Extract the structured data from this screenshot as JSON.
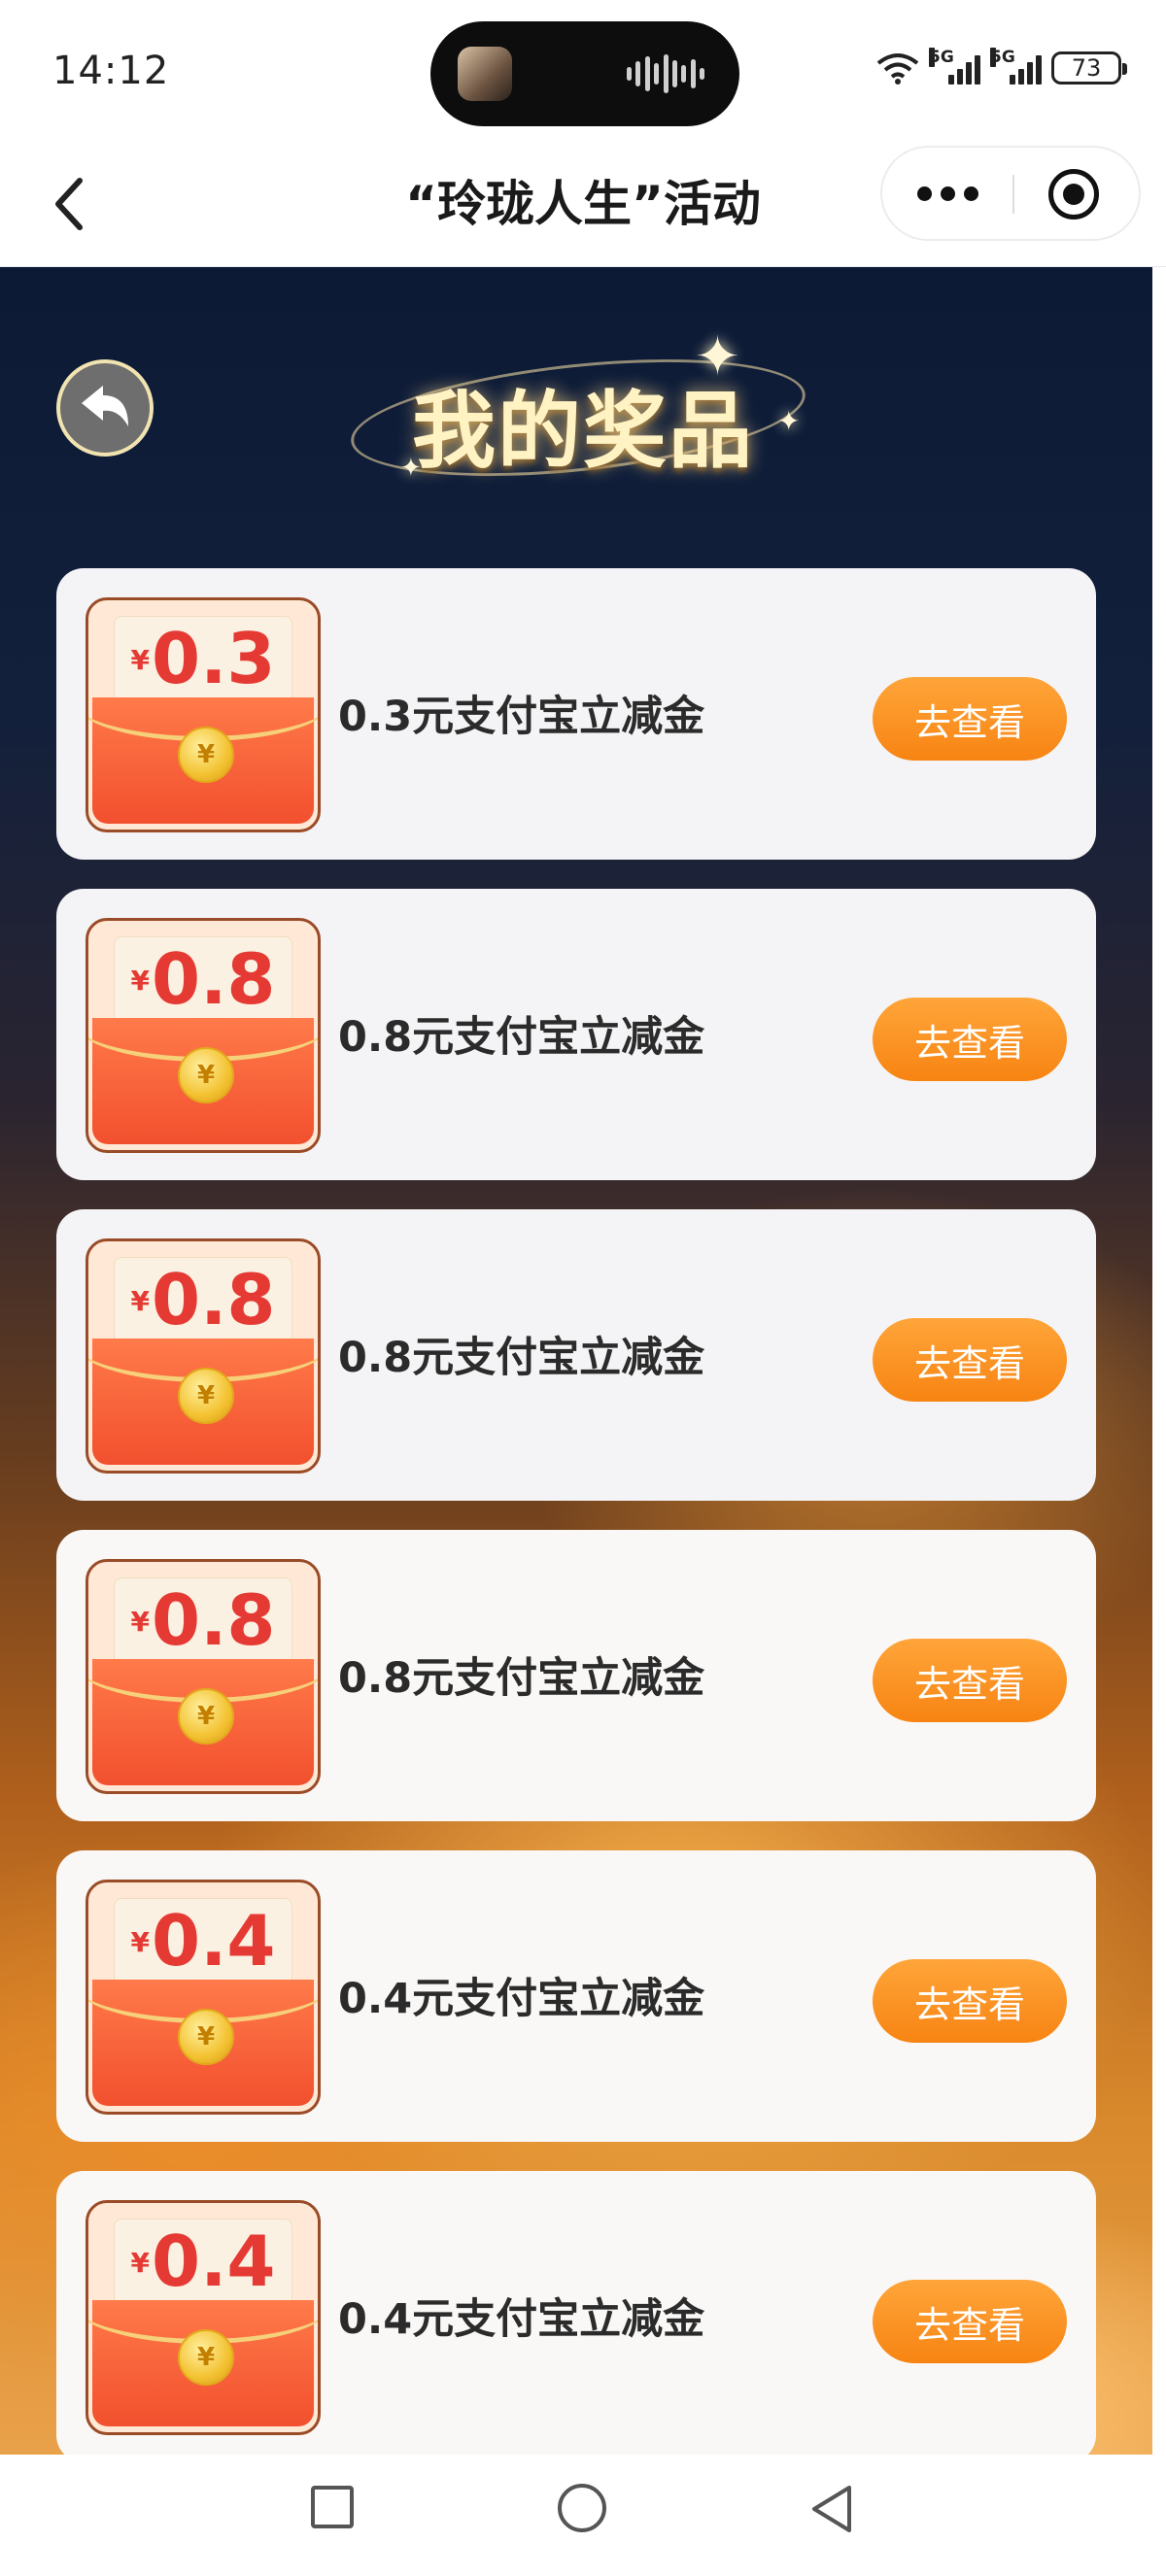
{
  "status_bar": {
    "time": "14:12",
    "signal_1_tag": "5G",
    "signal_2_tag": "5G",
    "battery": "73"
  },
  "nav": {
    "title": "“玲珑人生”活动"
  },
  "page": {
    "heading": "我的奖品"
  },
  "prizes": [
    {
      "currency": "¥",
      "amount": "0.3",
      "name": "0.3元支付宝立减金",
      "button": "去查看"
    },
    {
      "currency": "¥",
      "amount": "0.8",
      "name": "0.8元支付宝立减金",
      "button": "去查看"
    },
    {
      "currency": "¥",
      "amount": "0.8",
      "name": "0.8元支付宝立减金",
      "button": "去查看"
    },
    {
      "currency": "¥",
      "amount": "0.8",
      "name": "0.8元支付宝立减金",
      "button": "去查看"
    },
    {
      "currency": "¥",
      "amount": "0.4",
      "name": "0.4元支付宝立减金",
      "button": "去查看"
    },
    {
      "currency": "¥",
      "amount": "0.4",
      "name": "0.4元支付宝立减金",
      "button": "去查看"
    }
  ],
  "colors": {
    "accent_button": "#f78412",
    "amount_red": "#e53a33",
    "background_top": "#0c1a36"
  }
}
